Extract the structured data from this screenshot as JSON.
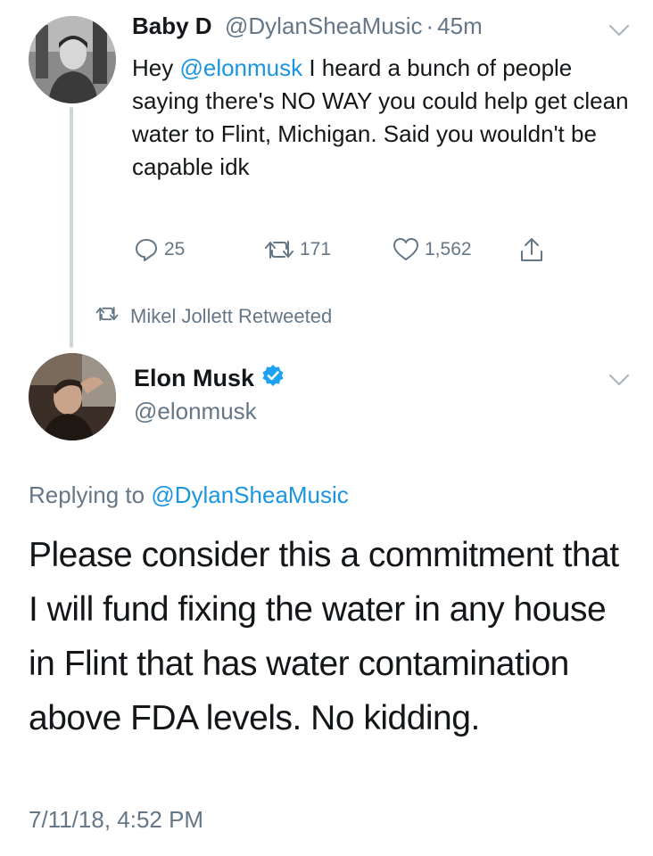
{
  "first_tweet": {
    "display_name": "Baby D",
    "handle": "@DylanSheaMusic",
    "separator": "·",
    "time_ago": "45m",
    "text_prefix": "Hey ",
    "mention": "@elonmusk",
    "text_rest": " I heard a bunch of people saying there's NO WAY you could help get clean water to Flint, Michigan. Said you wouldn't be capable idk",
    "reply_count": "25",
    "retweet_count": "171",
    "like_count": "1,562"
  },
  "retweet_context": {
    "label": "Mikel Jollett Retweeted"
  },
  "main_tweet": {
    "display_name": "Elon Musk",
    "verified": true,
    "handle": "@elonmusk",
    "replying_prefix": "Replying to ",
    "replying_to": "@DylanSheaMusic",
    "text": "Please consider this a commitment that I will fund fixing the water in any house in Flint that has water contamination above FDA levels. No kidding.",
    "timestamp": "7/11/18, 4:52 PM"
  },
  "colors": {
    "link_blue": "#1b95e0",
    "muted_gray": "#657786",
    "text": "#14171a",
    "thread_line": "#ccd6dd",
    "verified_badge": "#1da1f2"
  },
  "icons": [
    "reply-icon",
    "retweet-icon",
    "like-icon",
    "share-icon",
    "chevron-down-icon",
    "verified-badge-icon"
  ]
}
